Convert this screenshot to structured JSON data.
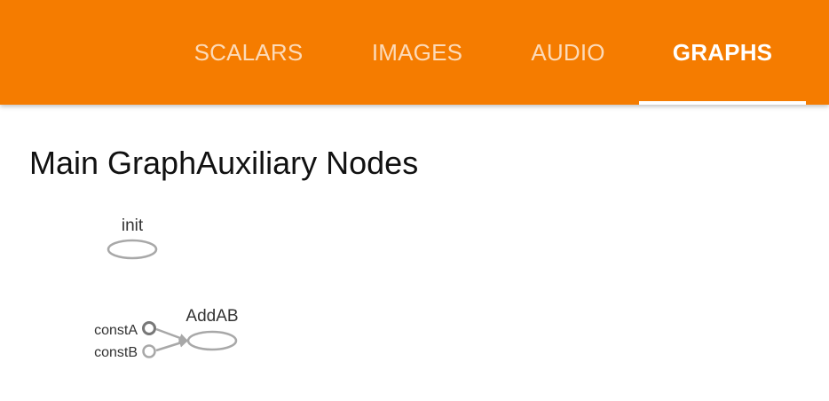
{
  "tabs": [
    {
      "label": "SCALARS",
      "active": false
    },
    {
      "label": "IMAGES",
      "active": false
    },
    {
      "label": "AUDIO",
      "active": false
    },
    {
      "label": "GRAPHS",
      "active": true
    }
  ],
  "main": {
    "title": "Main GraphAuxiliary Nodes"
  },
  "graph": {
    "nodes": {
      "init": "init",
      "addab": "AddAB",
      "consta": "constA",
      "constb": "constB"
    }
  },
  "colors": {
    "topbar": "#f57c00",
    "tab_inactive": "#fcd0a4",
    "tab_active": "#ffffff",
    "node_stroke": "#a0a0a0",
    "edge": "#a8a8a8",
    "text": "#111111"
  }
}
